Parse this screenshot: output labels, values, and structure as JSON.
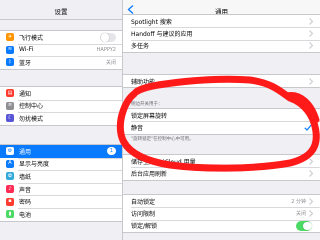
{
  "sidebar": {
    "title": "设置",
    "group1": [
      {
        "label": "飞行模式",
        "icon": "airplane-icon",
        "color": "#ff9500",
        "glyph": "✈",
        "accessory": "toggle-off"
      },
      {
        "label": "Wi-Fi",
        "icon": "wifi-icon",
        "color": "#0a7aff",
        "glyph": "≋",
        "value": "HAPPY2"
      },
      {
        "label": "蓝牙",
        "icon": "bluetooth-icon",
        "color": "#0a7aff",
        "glyph": "ᛒ",
        "value": "关闭"
      }
    ],
    "group2": [
      {
        "label": "通知",
        "icon": "notifications-icon",
        "color": "#ff3b30",
        "glyph": "▤"
      },
      {
        "label": "控制中心",
        "icon": "control-center-icon",
        "color": "#8e8e93",
        "glyph": "≡"
      },
      {
        "label": "勿扰模式",
        "icon": "do-not-disturb-icon",
        "color": "#5856d6",
        "glyph": "☾"
      }
    ],
    "group3": [
      {
        "label": "通用",
        "icon": "gear-icon",
        "color": "#8e8e93",
        "glyph": "⚙",
        "badge": "1",
        "selected": true
      },
      {
        "label": "显示与亮度",
        "icon": "display-brightness-icon",
        "color": "#0a7aff",
        "glyph": "A"
      },
      {
        "label": "墙纸",
        "icon": "wallpaper-icon",
        "color": "#34aadc",
        "glyph": "✿"
      },
      {
        "label": "声音",
        "icon": "sound-icon",
        "color": "#ff2d55",
        "glyph": "♪"
      },
      {
        "label": "密码",
        "icon": "passcode-icon",
        "color": "#ff3b30",
        "glyph": "▪"
      },
      {
        "label": "电池",
        "icon": "battery-icon",
        "color": "#4cd964",
        "glyph": "▮"
      }
    ]
  },
  "detail": {
    "title": "通用",
    "group1": [
      {
        "label": "Spotlight 搜索"
      },
      {
        "label": "Handoff 与建议的应用"
      },
      {
        "label": "多任务"
      }
    ],
    "group2": [
      {
        "label": "辅助功能"
      }
    ],
    "side_switch_header": "侧边开关用于：",
    "side_switch_options": [
      {
        "label": "锁定屏幕旋转",
        "checked": false
      },
      {
        "label": "静音",
        "checked": true
      }
    ],
    "side_switch_footer": "\"旋转锁定\"在控制中心中可用。",
    "group4": [
      {
        "label": "储存空间与 iCloud 用量"
      },
      {
        "label": "后台应用刷新"
      }
    ],
    "group5": [
      {
        "label": "自动锁定",
        "value": "2 分钟"
      },
      {
        "label": "访问限制",
        "value": "关闭"
      },
      {
        "label": "锁定/解锁",
        "accessory": "toggle-on"
      }
    ]
  },
  "colors": {
    "accent": "#0a7aff",
    "annotation": "#ff1a1a",
    "toggle_on": "#4cd964"
  }
}
